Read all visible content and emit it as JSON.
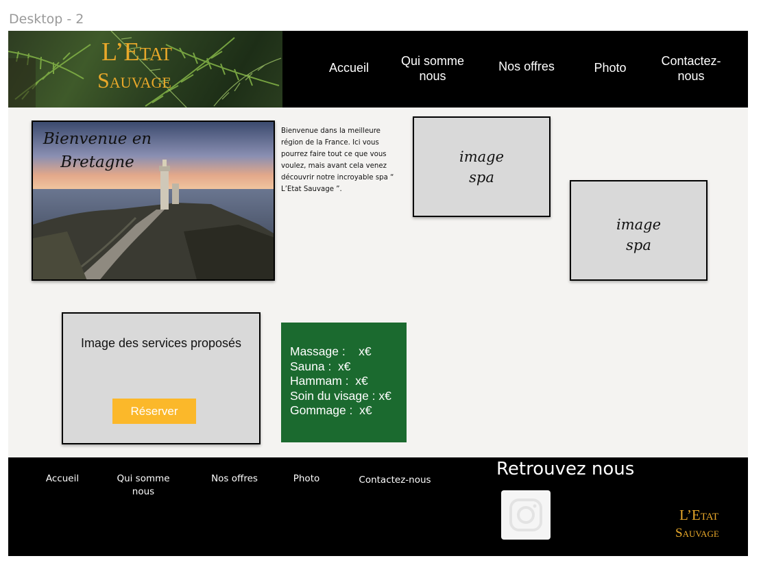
{
  "frame": {
    "label": "Desktop - 2"
  },
  "header": {
    "brand_line1": "L’Etat",
    "brand_line2": "Sauvage",
    "nav": [
      {
        "label": "Accueil"
      },
      {
        "label": "Qui somme nous"
      },
      {
        "label": "Nos offres"
      },
      {
        "label": "Photo"
      },
      {
        "label": "Contactez-nous"
      }
    ]
  },
  "hero": {
    "caption": "Bienvenue en Bretagne",
    "intro": "Bienvenue dans la meilleure région de la France. Ici vous pourrez faire tout ce que vous voulez, mais avant cela venez découvrir notre incroyable spa “ L’Etat Sauvage ”."
  },
  "placeholders": [
    {
      "label": "image spa"
    },
    {
      "label": "image spa"
    }
  ],
  "services": {
    "title": "Image des services proposés",
    "reserve_label": "Réserver"
  },
  "prices": [
    "Massage :    x€",
    "Sauna :  x€",
    "Hammam :  x€",
    "Soin du visage : x€",
    "Gommage :  x€"
  ],
  "footer": {
    "nav": [
      {
        "label": "Accueil"
      },
      {
        "label": "Qui somme nous"
      },
      {
        "label": "Nos offres"
      },
      {
        "label": "Photo"
      },
      {
        "label": "Contactez-nous"
      }
    ],
    "find_us": "Retrouvez nous",
    "brand_line1": "L’Etat",
    "brand_line2": "Sauvage",
    "social_icon": "instagram-icon"
  },
  "colors": {
    "brand_gold": "#e8a82a",
    "header_bg": "#000000",
    "price_bg": "#1b6a2f",
    "reserve_btn": "#fbb82a",
    "placeholder": "#d9d9d9"
  }
}
